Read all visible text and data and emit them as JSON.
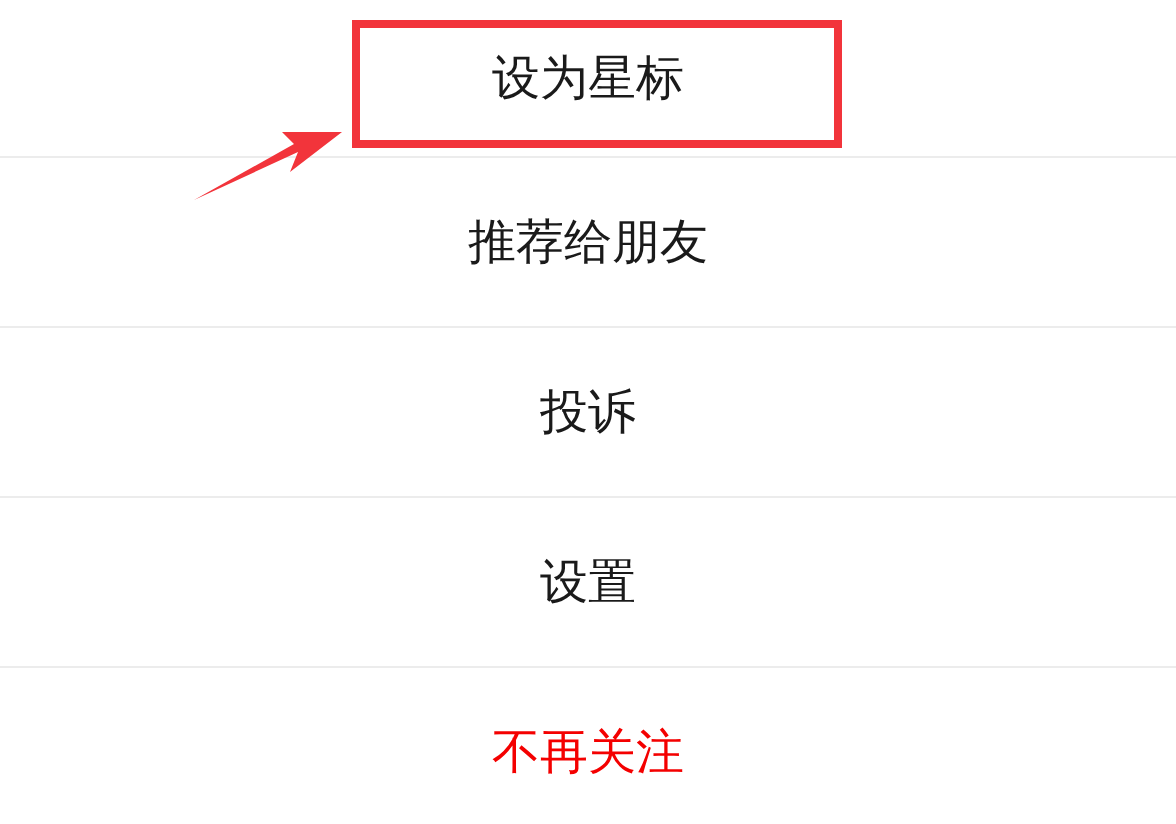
{
  "menu": {
    "items": [
      {
        "label": "设为星标",
        "kind": "normal",
        "annotated": true
      },
      {
        "label": "推荐给朋友",
        "kind": "normal",
        "annotated": false
      },
      {
        "label": "投诉",
        "kind": "normal",
        "annotated": false
      },
      {
        "label": "设置",
        "kind": "normal",
        "annotated": false
      },
      {
        "label": "不再关注",
        "kind": "danger",
        "annotated": false
      }
    ]
  }
}
